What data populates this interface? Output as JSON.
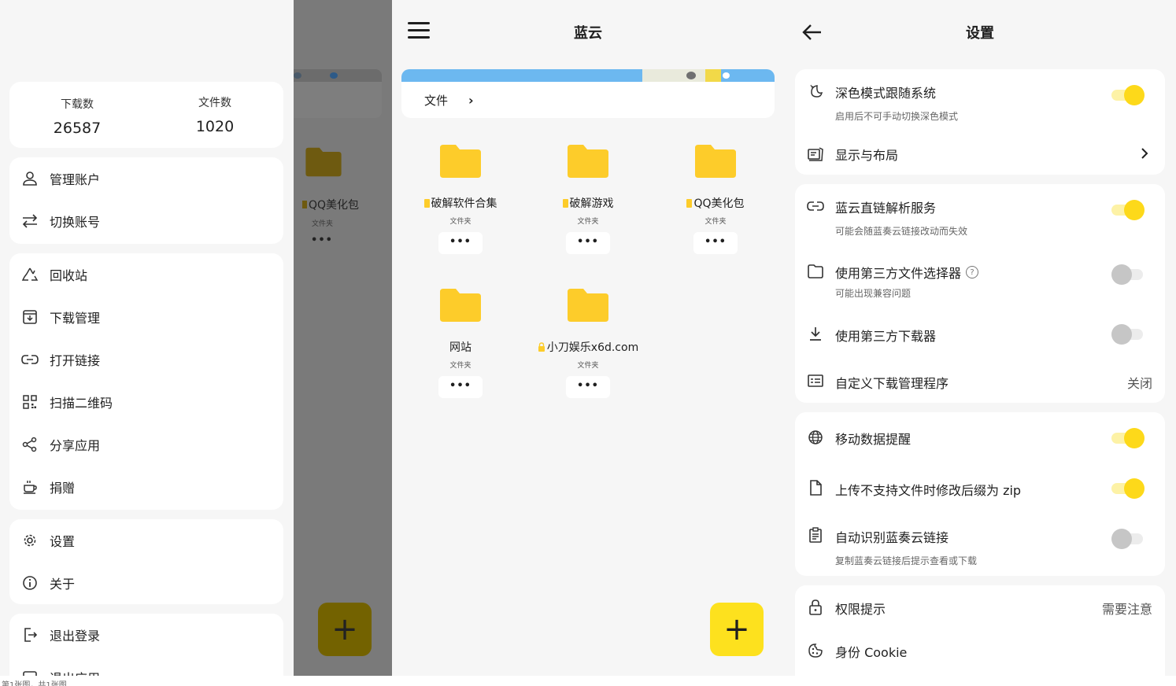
{
  "drawer": {
    "stats": {
      "downloads_label": "下载数",
      "downloads_value": "26587",
      "files_label": "文件数",
      "files_value": "1020"
    },
    "account": [
      {
        "label": "管理账户",
        "icon": "person-icon"
      },
      {
        "label": "切换账号",
        "icon": "swap-icon"
      }
    ],
    "tools": [
      {
        "label": "回收站",
        "icon": "recycle-icon"
      },
      {
        "label": "下载管理",
        "icon": "download-box-icon"
      },
      {
        "label": "打开链接",
        "icon": "link-icon"
      },
      {
        "label": "扫描二维码",
        "icon": "qr-code-icon"
      },
      {
        "label": "分享应用",
        "icon": "share-icon"
      },
      {
        "label": "捐赠",
        "icon": "coffee-cup-icon"
      }
    ],
    "misc": [
      {
        "label": "设置",
        "icon": "gear-icon"
      },
      {
        "label": "关于",
        "icon": "info-icon"
      }
    ],
    "exit": [
      {
        "label": "退出登录",
        "icon": "logout-icon"
      },
      {
        "label": "退出应用",
        "icon": "exit-app-icon"
      }
    ]
  },
  "scrim": {
    "folder_name": "QQ美化包",
    "folder_type": "文件夹",
    "more": "•••",
    "fab_symbol": "+"
  },
  "files": {
    "title": "蓝云",
    "breadcrumb": "文件",
    "breadcrumb_sep": "›",
    "folders": [
      {
        "name": "破解软件合集",
        "type": "文件夹",
        "more": "•••",
        "locked": false
      },
      {
        "name": "破解游戏",
        "type": "文件夹",
        "more": "•••",
        "locked": false
      },
      {
        "name": "QQ美化包",
        "type": "文件夹",
        "more": "•••",
        "locked": false
      },
      {
        "name": "网站",
        "type": "文件夹",
        "more": "•••",
        "locked": false
      },
      {
        "name": "小刀娱乐x6d.com",
        "type": "文件夹",
        "more": "•••",
        "locked": true
      }
    ],
    "fab_symbol": "+"
  },
  "settings": {
    "title": "设置",
    "rows": {
      "dark_mode": {
        "title": "深色模式跟随系统",
        "subtitle": "启用后不可手动切换深色模式",
        "toggle": true,
        "icon": "moon-icon"
      },
      "display": {
        "title": "显示与布局",
        "icon": "display-layout-icon"
      },
      "direct_link": {
        "title": "蓝云直链解析服务",
        "subtitle": "可能会随蓝奏云链接改动而失效",
        "toggle": true,
        "icon": "link-icon"
      },
      "third_picker": {
        "title": "使用第三方文件选择器",
        "subtitle": "可能出现兼容问题",
        "toggle": false,
        "icon": "folder-icon",
        "help": "?"
      },
      "third_downloader": {
        "title": "使用第三方下载器",
        "toggle": false,
        "icon": "download-icon"
      },
      "custom_dl": {
        "title": "自定义下载管理程序",
        "value": "关闭",
        "icon": "list-box-icon"
      },
      "mobile_data": {
        "title": "移动数据提醒",
        "toggle": true,
        "icon": "globe-icon"
      },
      "zip_upload": {
        "title": "上传不支持文件时修改后缀为 zip",
        "toggle": true,
        "icon": "file-icon"
      },
      "auto_detect": {
        "title": "自动识别蓝奏云链接",
        "subtitle": "复制蓝奏云链接后提示查看或下载",
        "toggle": false,
        "icon": "clipboard-icon"
      },
      "permission": {
        "title": "权限提示",
        "value": "需要注意",
        "icon": "lock-icon"
      },
      "cookie": {
        "title": "身份 Cookie",
        "icon": "cookie-icon"
      }
    }
  },
  "colors": {
    "accent": "#fde11e",
    "folder": "#fdcc2a",
    "scrim": "#7a7a7a"
  },
  "footnote": "第1张图，共1张图"
}
